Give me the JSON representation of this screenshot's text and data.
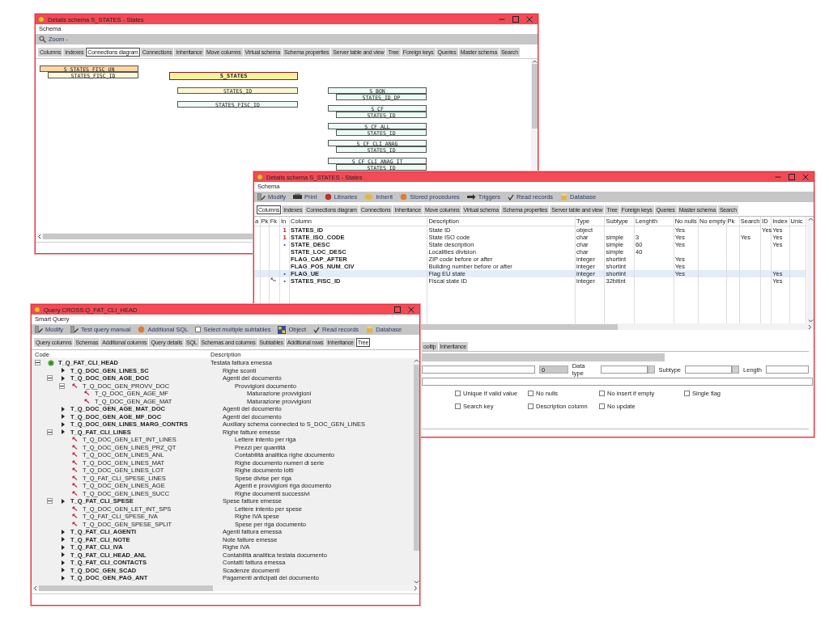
{
  "diagram_window": {
    "title": "Details schema S_STATES - States",
    "window_buttons": [
      {
        "kind": "minimize"
      },
      {
        "kind": "maximize"
      },
      {
        "kind": "close"
      }
    ],
    "menu": [
      "Schema"
    ],
    "toolbar": [
      {
        "kind": "button",
        "label": "Zoom -"
      }
    ],
    "tabs": [
      {
        "label": "Columns",
        "selected": false
      },
      {
        "label": "Indexes",
        "selected": false
      },
      {
        "label": "Connections diagram",
        "selected": true
      },
      {
        "label": "Connections",
        "selected": false
      },
      {
        "label": "Inheritance",
        "selected": false
      },
      {
        "label": "Move columns",
        "selected": false
      },
      {
        "label": "Virtual schema",
        "selected": false
      },
      {
        "label": "Schema properties",
        "selected": false
      },
      {
        "label": "Server table and view",
        "selected": false
      },
      {
        "label": "Tree",
        "selected": false
      },
      {
        "label": "Foreign keys",
        "selected": false
      },
      {
        "label": "Queries",
        "selected": false
      },
      {
        "label": "Master schema",
        "selected": false
      },
      {
        "label": "Search",
        "selected": false
      }
    ],
    "diagram": {
      "table": "S_STATES",
      "columns": [
        {
          "name": "STATES_ID",
          "primary_key": true,
          "referenced_by": [
            {
              "table": "S_BON",
              "column": "STATES_ID_DP"
            },
            {
              "table": "S_CF",
              "column": "STATES_ID"
            },
            {
              "table": "S_CF_ALL",
              "column": "STATES_ID"
            },
            {
              "table": "S_CF_CLI_ANAG",
              "column": "STATES_ID"
            },
            {
              "table": "S_CF_CLI_ANAG_IT",
              "column": "STATES_ID"
            }
          ]
        },
        {
          "name": "STATES_FISC_ID",
          "primary_key": false,
          "references": [
            {
              "table": "S_STATES_FISC_UN",
              "column": "STATES_FISC_ID"
            }
          ]
        }
      ]
    }
  },
  "schema_window": {
    "title": "Details schema S_STATES - States",
    "window_buttons": [
      {
        "kind": "minimize"
      },
      {
        "kind": "maximize"
      },
      {
        "kind": "close"
      }
    ],
    "menu": [
      "Schema"
    ],
    "toolbar": [
      {
        "kind": "button",
        "label": "Modify"
      },
      {
        "kind": "button",
        "label": "Print"
      },
      {
        "kind": "button",
        "label": "Libraries"
      },
      {
        "kind": "button",
        "label": "Inherit"
      },
      {
        "kind": "button",
        "label": "Stored procedures"
      },
      {
        "kind": "button",
        "label": "Triggers"
      },
      {
        "kind": "button",
        "label": "Read records"
      },
      {
        "kind": "button",
        "label": "Database"
      }
    ],
    "tabs": [
      {
        "label": "Columns",
        "selected": true
      },
      {
        "label": "Indexes",
        "selected": false
      },
      {
        "label": "Connections diagram",
        "selected": false
      },
      {
        "label": "Connections",
        "selected": false
      },
      {
        "label": "Inheritance",
        "selected": false
      },
      {
        "label": "Move columns",
        "selected": false
      },
      {
        "label": "Virtual schema",
        "selected": false
      },
      {
        "label": "Schema properties",
        "selected": false
      },
      {
        "label": "Server table and view",
        "selected": false
      },
      {
        "label": "Tree",
        "selected": false
      },
      {
        "label": "Foreign keys",
        "selected": false
      },
      {
        "label": "Queries",
        "selected": false
      },
      {
        "label": "Master schema",
        "selected": false
      },
      {
        "label": "Search",
        "selected": false
      }
    ],
    "table": {
      "columns": [
        "a",
        "Pk",
        "Fk",
        "In",
        "Column",
        "Description",
        "Type",
        "Subtype",
        "Lenghth",
        "No nulls",
        "No empty",
        "Pk",
        "Search",
        "ID",
        "Index",
        "Unic"
      ],
      "rows": [
        {
          "selected": false,
          "fk": false,
          "in_mark": {
            "kind": "unique",
            "text": "1"
          },
          "column": "STATES_ID",
          "description": "State ID",
          "type": "object",
          "no_nulls": "Yes",
          "id": "Yes",
          "index": "Yes"
        },
        {
          "selected": false,
          "fk": false,
          "in_mark": {
            "kind": "unique",
            "text": "1"
          },
          "column": "STATE_ISO_CODE",
          "description": "State ISO code",
          "type": "char",
          "subtype": "simple",
          "length": "3",
          "no_nulls": "Yes",
          "search": "Yes",
          "index": "Yes"
        },
        {
          "selected": false,
          "fk": false,
          "in_mark": {
            "kind": "index",
            "text": "•"
          },
          "column": "STATE_DESC",
          "description": "State description",
          "type": "char",
          "subtype": "simple",
          "length": "60",
          "no_nulls": "Yes",
          "index": "Yes"
        },
        {
          "selected": false,
          "fk": false,
          "column": "STATE_LOC_DESC",
          "description": "Localities division",
          "type": "char",
          "subtype": "simple",
          "length": "40"
        },
        {
          "selected": false,
          "fk": false,
          "column": "FLAG_CAP_AFTER",
          "description": "ZIP code before or after",
          "type": "integer",
          "subtype": "shortint",
          "no_nulls": "Yes"
        },
        {
          "selected": false,
          "fk": false,
          "column": "FLAG_POS_NUM_CIV",
          "description": "Building number before or after",
          "type": "integer",
          "subtype": "shortint",
          "no_nulls": "Yes"
        },
        {
          "selected": true,
          "fk": false,
          "in_mark": {
            "kind": "index",
            "text": "•"
          },
          "column": "FLAG_UE",
          "description": "Flag EU state",
          "type": "integer",
          "subtype": "shortint",
          "no_nulls": "Yes",
          "index": "Yes"
        },
        {
          "selected": false,
          "fk": true,
          "in_mark": {
            "kind": "index",
            "text": "•"
          },
          "column": "STATES_FISC_ID",
          "description": "Fiscal state ID",
          "type": "integer",
          "subtype": "32bitint",
          "index": "Yes"
        }
      ]
    },
    "detail": {
      "tabs": [
        {
          "label": "ooltip",
          "selected": false
        },
        {
          "label": "Inheritance",
          "selected": false
        }
      ],
      "order_value": "0",
      "labels": [
        "Data type",
        "Subtype",
        "Length"
      ],
      "checkboxes": [
        {
          "label": "Unique if valid value",
          "checked": false
        },
        {
          "label": "No nulls",
          "checked": false
        },
        {
          "label": "No insert if empty",
          "checked": false
        },
        {
          "label": "Single flag",
          "checked": false
        },
        {
          "label": "Search key",
          "checked": false
        },
        {
          "label": "Description column",
          "checked": false
        },
        {
          "label": "No update",
          "checked": false
        }
      ]
    }
  },
  "query_window": {
    "title": "Query CROSS:Q_FAT_CLI_HEAD",
    "window_buttons": [
      {
        "kind": "maximize"
      },
      {
        "kind": "close"
      }
    ],
    "menu": [
      "Smart Query"
    ],
    "toolbar": [
      {
        "kind": "button",
        "label": "Modify"
      },
      {
        "kind": "button",
        "label": "Test query manual"
      },
      {
        "kind": "button",
        "label": "Additional SQL"
      },
      {
        "kind": "checkbox",
        "label": "Select multiple subtables",
        "checked": false
      },
      {
        "kind": "button",
        "label": "Object"
      },
      {
        "kind": "button",
        "label": "Read records"
      },
      {
        "kind": "button",
        "label": "Database"
      }
    ],
    "tabs": [
      {
        "label": "Query columns",
        "selected": false
      },
      {
        "label": "Schemas",
        "selected": false
      },
      {
        "label": "Additional columns",
        "selected": false
      },
      {
        "label": "Query details",
        "selected": false
      },
      {
        "label": "SQL",
        "selected": false
      },
      {
        "label": "Schemas and columns",
        "selected": false
      },
      {
        "label": "Subtables",
        "selected": false
      },
      {
        "label": "Additional rows",
        "selected": false
      },
      {
        "label": "Inheritance",
        "selected": false
      },
      {
        "label": "Tree",
        "selected": true
      }
    ],
    "tree": {
      "columns": [
        "Code",
        "Description"
      ],
      "nodes": [
        {
          "code": "T_Q_FAT_CLI_HEAD",
          "description": "Testata fattura emessa",
          "kind": "root",
          "expanded": true,
          "children": [
            {
              "code": "T_Q_DOC_GEN_LINES_SC",
              "description": "Righe sconti",
              "kind": "table"
            },
            {
              "code": "T_Q_DOC_GEN_AGE_DOC",
              "description": "Agenti del documento",
              "kind": "table",
              "expanded": true,
              "children": [
                {
                  "code": "T_Q_DOC_GEN_PROVV_DOC",
                  "description": "Provvigioni documento",
                  "kind": "link",
                  "expanded": true,
                  "children": [
                    {
                      "code": "T_Q_DOC_GEN_AGE_MF",
                      "description": "Maturazione provvigioni",
                      "kind": "link"
                    },
                    {
                      "code": "T_Q_DOC_GEN_AGE_MAT",
                      "description": "Maturazione provvigioni",
                      "kind": "link"
                    }
                  ]
                }
              ]
            },
            {
              "code": "T_Q_DOC_GEN_AGE_MAT_DOC",
              "description": "Agenti del documento",
              "kind": "table"
            },
            {
              "code": "T_Q_DOC_GEN_AGE_MF_DOC",
              "description": "Agenti del documento",
              "kind": "table"
            },
            {
              "code": "T_Q_DOC_GEN_LINES_MARG_CONTRS",
              "description": "Auxiliary schema connected to S_DOC_GEN_LINES",
              "kind": "table"
            },
            {
              "code": "T_Q_FAT_CLI_LINES",
              "description": "Righe fatture emesse",
              "kind": "table",
              "expanded": true,
              "children": [
                {
                  "code": "T_Q_DOC_GEN_LET_INT_LINES",
                  "description": "Lettere intento per riga",
                  "kind": "link"
                },
                {
                  "code": "T_Q_DOC_GEN_LINES_PRZ_QT",
                  "description": "Prezzi per quantità",
                  "kind": "link"
                },
                {
                  "code": "T_Q_DOC_GEN_LINES_ANL",
                  "description": "Contabilità analitica righe documento",
                  "kind": "link"
                },
                {
                  "code": "T_Q_DOC_GEN_LINES_MAT",
                  "description": "Righe documento numeri di serie",
                  "kind": "link"
                },
                {
                  "code": "T_Q_DOC_GEN_LINES_LOT",
                  "description": "Righe documento lotti",
                  "kind": "link"
                },
                {
                  "code": "T_Q_FAT_CLI_SPESE_LINES",
                  "description": "Spese divise per riga",
                  "kind": "link"
                },
                {
                  "code": "T_Q_DOC_GEN_LINES_AGE",
                  "description": "Agenti e provvigioni riga documento",
                  "kind": "link"
                },
                {
                  "code": "T_Q_DOC_GEN_LINES_SUCC",
                  "description": "Righe documenti successivi",
                  "kind": "link"
                }
              ]
            },
            {
              "code": "T_Q_FAT_CLI_SPESE",
              "description": "Spese fatture emesse",
              "kind": "table",
              "expanded": true,
              "children": [
                {
                  "code": "T_Q_DOC_GEN_LET_INT_SPS",
                  "description": "Lettere intento per spese",
                  "kind": "link"
                },
                {
                  "code": "T_Q_FAT_CLI_SPESE_IVA",
                  "description": "Righe IVA spese",
                  "kind": "link"
                },
                {
                  "code": "T_Q_DOC_GEN_SPESE_SPLIT",
                  "description": "Spese per riga documento",
                  "kind": "link"
                }
              ]
            },
            {
              "code": "T_Q_FAT_CLI_AGENTI",
              "description": "Agenti fattura emessa",
              "kind": "table"
            },
            {
              "code": "T_Q_FAT_CLI_NOTE",
              "description": "Note fatture emesse",
              "kind": "table"
            },
            {
              "code": "T_Q_FAT_CLI_IVA",
              "description": "Righe IVA",
              "kind": "table"
            },
            {
              "code": "T_Q_FAT_CLI_HEAD_ANL",
              "description": "Contabilità analitica testata documento",
              "kind": "table"
            },
            {
              "code": "T_Q_FAT_CLI_CONTACTS",
              "description": "Contatti fattura emessa",
              "kind": "table"
            },
            {
              "code": "T_Q_DOC_GEN_SCAD",
              "description": "Scadenze documenti",
              "kind": "table"
            },
            {
              "code": "T_Q_DOC_GEN_PAG_ANT",
              "description": "Pagamenti anticipati del documento",
              "kind": "table"
            }
          ]
        }
      ]
    }
  }
}
